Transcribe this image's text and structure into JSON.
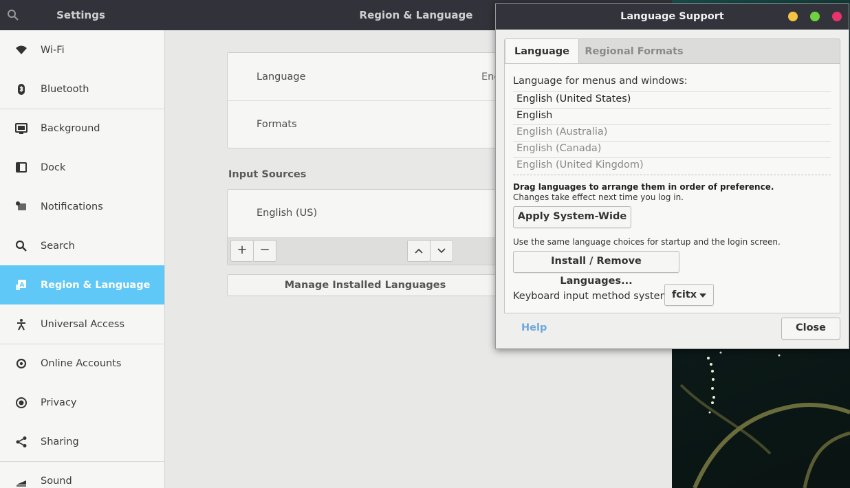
{
  "settings": {
    "window_title": "Settings",
    "panel_title": "Region & Language",
    "sidebar": [
      {
        "label": "Wi-Fi",
        "icon": "wifi-icon"
      },
      {
        "label": "Bluetooth",
        "icon": "bluetooth-icon"
      },
      {
        "label": "Background",
        "icon": "background-icon"
      },
      {
        "label": "Dock",
        "icon": "dock-icon"
      },
      {
        "label": "Notifications",
        "icon": "notifications-icon"
      },
      {
        "label": "Search",
        "icon": "search-icon"
      },
      {
        "label": "Region & Language",
        "icon": "region-language-icon",
        "active": true
      },
      {
        "label": "Universal Access",
        "icon": "universal-access-icon"
      },
      {
        "label": "Online Accounts",
        "icon": "online-accounts-icon"
      },
      {
        "label": "Privacy",
        "icon": "privacy-icon"
      },
      {
        "label": "Sharing",
        "icon": "sharing-icon"
      },
      {
        "label": "Sound",
        "icon": "sound-icon"
      }
    ],
    "language_label": "Language",
    "language_value_partial": "Eng",
    "formats_label": "Formats",
    "input_sources_header": "Input Sources",
    "input_source_item": "English (US)",
    "add_symbol": "+",
    "remove_symbol": "−",
    "manage_button": "Manage Installed Languages"
  },
  "dialog": {
    "title": "Language Support",
    "tabs": [
      "Language",
      "Regional Formats"
    ],
    "menus_label": "Language for menus and windows:",
    "languages": [
      {
        "name": "English (United States)",
        "enabled": true
      },
      {
        "name": "English",
        "enabled": true
      },
      {
        "name": "English (Australia)",
        "enabled": false
      },
      {
        "name": "English (Canada)",
        "enabled": false
      },
      {
        "name": "English (United Kingdom)",
        "enabled": false
      }
    ],
    "drag_hint": "Drag languages to arrange them in order of preference.",
    "effect_hint": "Changes take effect next time you log in.",
    "apply_button": "Apply System-Wide",
    "apply_hint": "Use the same language choices for startup and the login screen.",
    "install_button": "Install / Remove Languages...",
    "im_label": "Keyboard input method system:",
    "im_value": "fcitx",
    "help_label": "Help",
    "close_label": "Close",
    "colors": {
      "minimize": "#f5c542",
      "maximize": "#6fd13e",
      "close": "#e8336b",
      "help": "#6fa8dc",
      "accent": "#5fc8f7"
    }
  }
}
